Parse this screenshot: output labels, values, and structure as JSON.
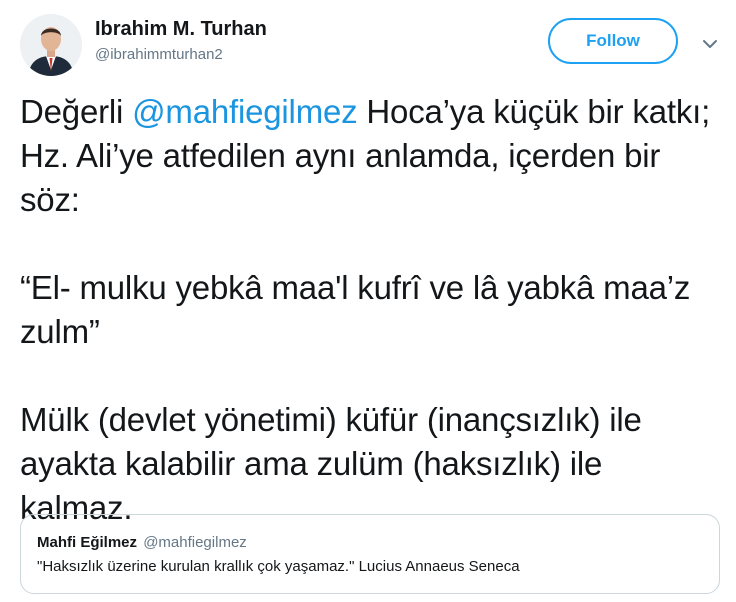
{
  "author": {
    "display_name": "Ibrahim M. Turhan",
    "screen_name": "@ibrahimmturhan2",
    "avatar_icon": "profile-photo"
  },
  "actions": {
    "follow_label": "Follow",
    "menu_icon": "chevron-down-icon"
  },
  "tweet": {
    "p1_before": "Değerli ",
    "p1_mention": "@mahfiegilmez",
    "p1_after": " Hoca’ya küçük bir katkı; Hz. Ali’ye atfedilen aynı anlamda, içerden bir söz:",
    "p2": "“El- mulku yebkâ maa'l kufrî ve lâ yabkâ maa’z zulm”",
    "p3": "Mülk (devlet yönetimi) küfür (inançsızlık) ile ayakta kalabilir ama zulüm (haksızlık) ile kalmaz."
  },
  "quote": {
    "name": "Mahfi Eğilmez",
    "handle": "@mahfiegilmez",
    "text": "\"Haksızlık üzerine kurulan krallık çok yaşamaz.\" Lucius Annaeus Seneca"
  },
  "colors": {
    "accent": "#1da1f2",
    "mention": "#1b95e0",
    "secondary_text": "#657786",
    "border": "#ccd6dd"
  }
}
